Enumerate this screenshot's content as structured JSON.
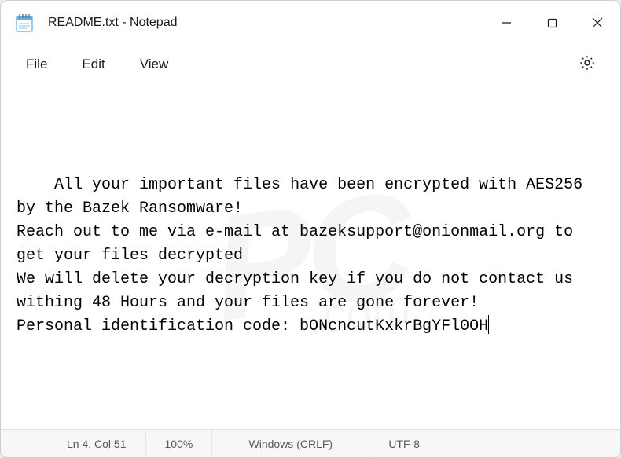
{
  "titlebar": {
    "title": "README.txt - Notepad"
  },
  "menubar": {
    "file": "File",
    "edit": "Edit",
    "view": "View"
  },
  "editor": {
    "content": "All your important files have been encrypted with AES256 by the Bazek Ransomware!\nReach out to me via e-mail at bazeksupport@onionmail.org to get your files decrypted\nWe will delete your decryption key if you do not contact us withing 48 Hours and your files are gone forever!\nPersonal identification code: bONcncutKxkrBgYFl0OH"
  },
  "statusbar": {
    "position": "Ln 4, Col 51",
    "zoom": "100%",
    "line_ending": "Windows (CRLF)",
    "encoding": "UTF-8"
  },
  "watermark": {
    "main": "PC",
    "sub": ".com"
  }
}
